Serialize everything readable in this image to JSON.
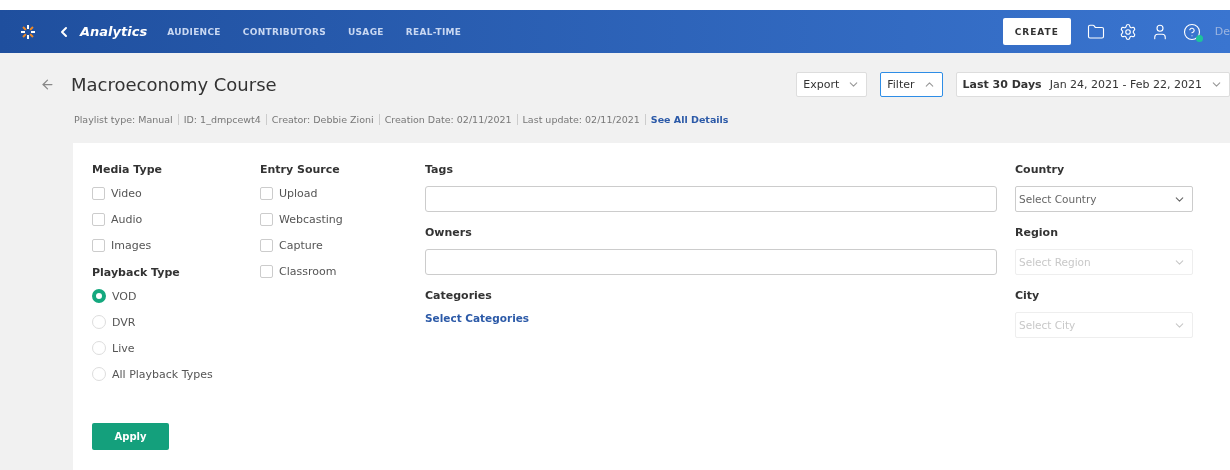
{
  "header": {
    "app_title": "Analytics",
    "nav": [
      {
        "label": "AUDIENCE"
      },
      {
        "label": "CONTRIBUTORS"
      },
      {
        "label": "USAGE"
      },
      {
        "label": "REAL-TIME"
      }
    ],
    "create_button": "CREATE",
    "help_online": true,
    "user": "De"
  },
  "page": {
    "title": "Macroeconomy Course",
    "meta": [
      "Playlist type: Manual",
      "ID: 1_dmpcewt4",
      "Creator: Debbie Zioni",
      "Creation Date: 02/11/2021",
      "Last update: 02/11/2021"
    ],
    "details_link": "See All Details"
  },
  "toolbar": {
    "export": {
      "label": "Export",
      "open": false
    },
    "filter": {
      "label": "Filter",
      "open": true
    },
    "date_range": {
      "label": "Last 30 Days",
      "value": "Jan 24, 2021 - Feb 22, 2021"
    }
  },
  "filters": {
    "media_type": {
      "title": "Media Type",
      "options": [
        {
          "label": "Video",
          "checked": false
        },
        {
          "label": "Audio",
          "checked": false
        },
        {
          "label": "Images",
          "checked": false
        }
      ]
    },
    "playback_type": {
      "title": "Playback Type",
      "options": [
        {
          "label": "VOD",
          "selected": true
        },
        {
          "label": "DVR",
          "selected": false
        },
        {
          "label": "Live",
          "selected": false
        },
        {
          "label": "All Playback Types",
          "selected": false
        }
      ]
    },
    "entry_source": {
      "title": "Entry Source",
      "options": [
        {
          "label": "Upload",
          "checked": false
        },
        {
          "label": "Webcasting",
          "checked": false
        },
        {
          "label": "Capture",
          "checked": false
        },
        {
          "label": "Classroom",
          "checked": false
        }
      ]
    },
    "tags": {
      "label": "Tags"
    },
    "owners": {
      "label": "Owners"
    },
    "categories": {
      "label": "Categories",
      "link": "Select Categories"
    },
    "location": [
      {
        "label": "Country",
        "placeholder": "Select Country",
        "disabled": false
      },
      {
        "label": "Region",
        "placeholder": "Select Region",
        "disabled": true
      },
      {
        "label": "City",
        "placeholder": "Select City",
        "disabled": true
      }
    ],
    "apply_button": "Apply"
  }
}
